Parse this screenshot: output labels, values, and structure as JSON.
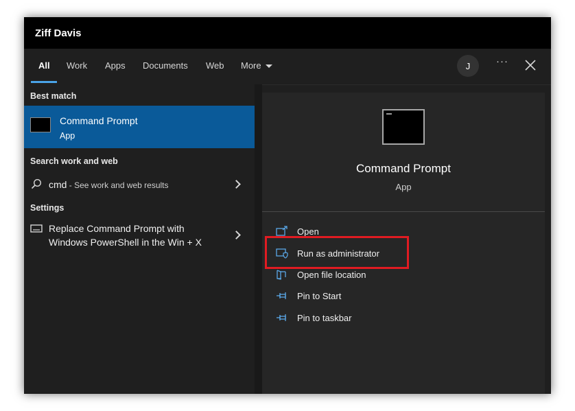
{
  "window": {
    "title": "Ziff Davis"
  },
  "tabs": {
    "items": [
      "All",
      "Work",
      "Apps",
      "Documents",
      "Web",
      "More"
    ],
    "active": "All"
  },
  "header": {
    "avatar_initial": "J",
    "more_options": "···"
  },
  "results": {
    "best_match_label": "Best match",
    "best_match": {
      "name": "Command Prompt",
      "type": "App",
      "icon": "command-prompt-icon"
    },
    "search_web_label": "Search work and web",
    "search_web": {
      "query": "cmd",
      "suffix": " - See work and web results",
      "icon": "search-icon"
    },
    "settings_label": "Settings",
    "setting": {
      "line1": "Replace Command Prompt with",
      "line2": "Windows PowerShell in the Win + X",
      "icon": "keyboard-icon"
    }
  },
  "preview": {
    "app_name": "Command Prompt",
    "app_type": "App",
    "icon": "command-prompt-icon",
    "actions": [
      {
        "label": "Open",
        "icon": "open-icon"
      },
      {
        "label": "Run as administrator",
        "icon": "shield-icon"
      },
      {
        "label": "Open file location",
        "icon": "folder-icon"
      },
      {
        "label": "Pin to Start",
        "icon": "pin-icon"
      },
      {
        "label": "Pin to taskbar",
        "icon": "pin-icon"
      }
    ]
  },
  "colors": {
    "accent": "#0a5a99",
    "tab_underline": "#4aa3e8",
    "highlight": "#e11b22",
    "background": "#1f1f1f",
    "titlebar": "#000000"
  }
}
